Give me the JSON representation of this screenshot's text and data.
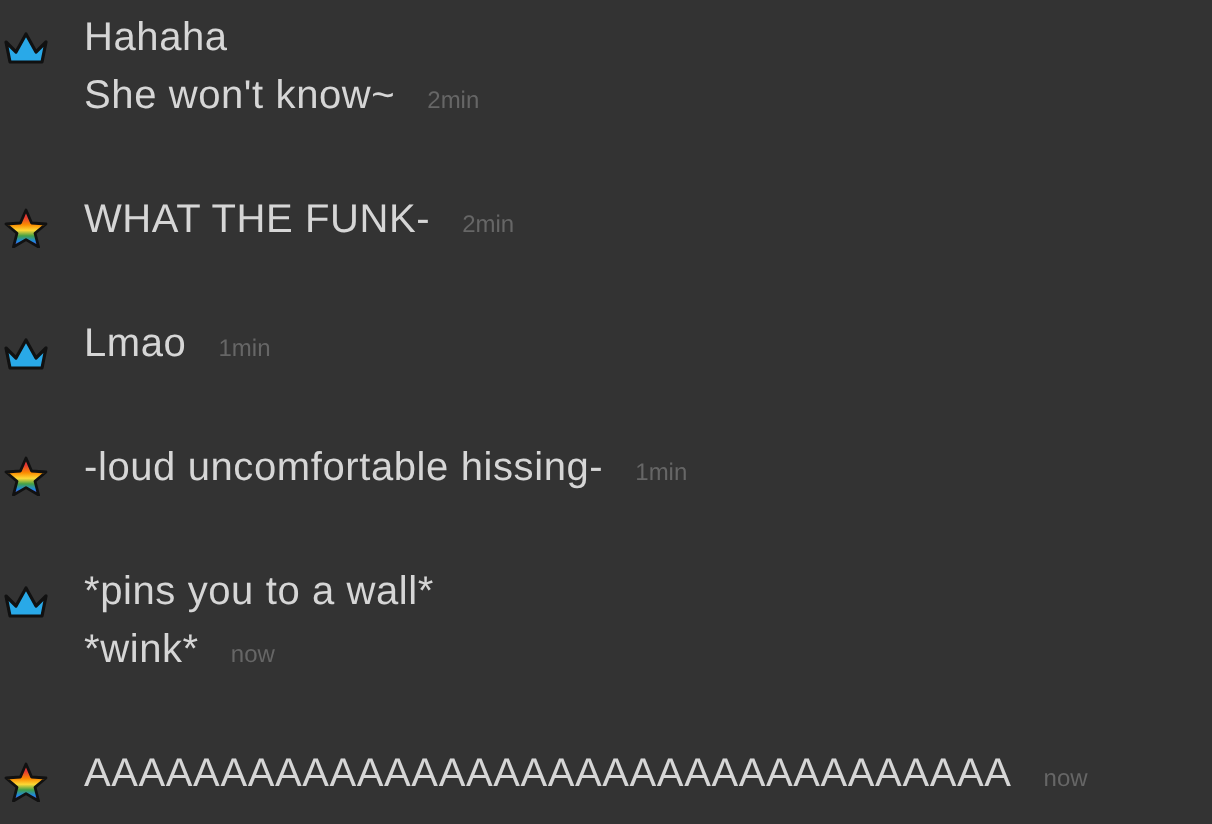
{
  "messages": [
    {
      "kind": "crown",
      "lines": [
        "Hahaha",
        "She won't know~"
      ],
      "time": "2min"
    },
    {
      "kind": "star",
      "lines": [
        "WHAT THE FUNK-"
      ],
      "time": "2min"
    },
    {
      "kind": "crown",
      "lines": [
        "Lmao"
      ],
      "time": "1min"
    },
    {
      "kind": "star",
      "lines": [
        "-loud uncomfortable hissing-"
      ],
      "time": "1min"
    },
    {
      "kind": "crown",
      "lines": [
        "*pins you to a wall*",
        "*wink*"
      ],
      "time": "now"
    },
    {
      "kind": "star",
      "lines": [
        "AAAAAAAAAAAAAAAAAAAAAAAAAAAAAAAAAA"
      ],
      "time": "now"
    }
  ]
}
